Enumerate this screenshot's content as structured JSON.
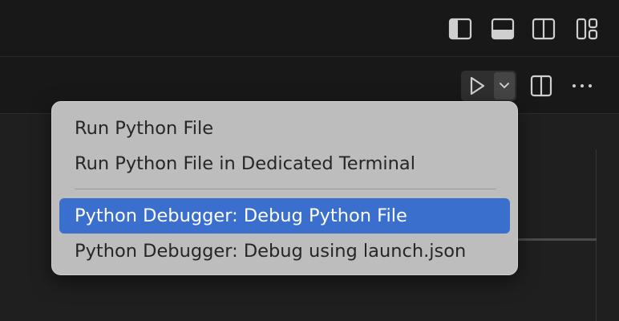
{
  "window": {
    "layout_buttons": [
      {
        "icon": "toggle-primary-sidebar-icon"
      },
      {
        "icon": "toggle-panel-icon"
      },
      {
        "icon": "toggle-secondary-sidebar-icon"
      },
      {
        "icon": "customize-layout-icon"
      }
    ]
  },
  "editor_actions": {
    "run_icon": "play-icon",
    "dropdown_icon": "chevron-down-icon",
    "split_icon": "split-editor-icon",
    "more_icon": "more-actions-icon",
    "more_label": "···"
  },
  "run_menu": {
    "items": [
      {
        "label": "Run Python File",
        "selected": false
      },
      {
        "label": "Run Python File in Dedicated Terminal",
        "selected": false
      },
      {
        "label": "Python Debugger: Debug Python File",
        "selected": true
      },
      {
        "label": "Python Debugger: Debug using launch.json",
        "selected": false
      }
    ]
  },
  "colors": {
    "selection_accent": "#3a6fcd",
    "menu_background": "#bdbdbd",
    "chrome_background": "#181818"
  }
}
